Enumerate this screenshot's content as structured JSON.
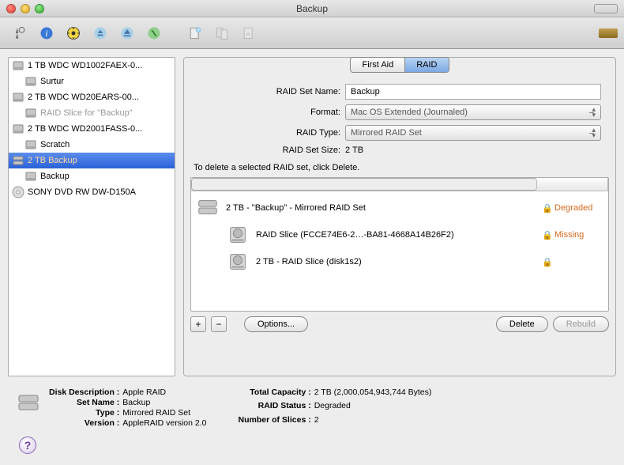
{
  "window": {
    "title": "Backup"
  },
  "sidebar": {
    "items": [
      {
        "label": "1 TB WDC WD1002FAEX-0...",
        "indent": 0,
        "icon": "hdd",
        "selected": false,
        "disabled": false
      },
      {
        "label": "Surtur",
        "indent": 1,
        "icon": "hdd",
        "selected": false,
        "disabled": false
      },
      {
        "label": "2 TB WDC WD20EARS-00...",
        "indent": 0,
        "icon": "hdd",
        "selected": false,
        "disabled": false
      },
      {
        "label": "RAID Slice for \"Backup\"",
        "indent": 1,
        "icon": "hdd",
        "selected": false,
        "disabled": true
      },
      {
        "label": "2 TB WDC WD2001FASS-0...",
        "indent": 0,
        "icon": "hdd",
        "selected": false,
        "disabled": false
      },
      {
        "label": "Scratch",
        "indent": 1,
        "icon": "hdd",
        "selected": false,
        "disabled": false
      },
      {
        "label": "2 TB Backup",
        "indent": 0,
        "icon": "raid",
        "selected": true,
        "disabled": false
      },
      {
        "label": "Backup",
        "indent": 1,
        "icon": "hdd",
        "selected": false,
        "disabled": false
      },
      {
        "label": "SONY DVD RW DW-D150A",
        "indent": 0,
        "icon": "optical",
        "selected": false,
        "disabled": false
      }
    ]
  },
  "tabs": {
    "first_aid": "First Aid",
    "raid": "RAID"
  },
  "form": {
    "name_label": "RAID Set Name:",
    "name_value": "Backup",
    "format_label": "Format:",
    "format_value": "Mac OS Extended (Journaled)",
    "type_label": "RAID Type:",
    "type_value": "Mirrored RAID Set",
    "size_label": "RAID Set Size:",
    "size_value": "2 TB"
  },
  "hint": "To delete a selected RAID set, click Delete.",
  "list": {
    "rows": [
      {
        "label": "2 TB - \"Backup\" - Mirrored RAID Set",
        "status": "Degraded",
        "locked": true,
        "child": false,
        "icon": "raid-stack"
      },
      {
        "label": "RAID Slice (FCCE74E6-2…-BA81-4668A14B26F2)",
        "status": "Missing",
        "locked": true,
        "child": true,
        "icon": "hdd-internal"
      },
      {
        "label": "2 TB - RAID Slice (disk1s2)",
        "status": "",
        "locked": true,
        "child": true,
        "icon": "hdd-internal"
      }
    ]
  },
  "actions": {
    "plus": "+",
    "minus": "−",
    "options": "Options...",
    "delete": "Delete",
    "rebuild": "Rebuild"
  },
  "footer": {
    "left": {
      "disk_desc_label": "Disk Description",
      "disk_desc_value": "Apple RAID",
      "set_name_label": "Set Name",
      "set_name_value": "Backup",
      "type_label": "Type",
      "type_value": "Mirrored RAID Set",
      "version_label": "Version",
      "version_value": "AppleRAID version 2.0"
    },
    "right": {
      "capacity_label": "Total Capacity",
      "capacity_value": "2 TB (2,000,054,943,744 Bytes)",
      "status_label": "RAID Status",
      "status_value": "Degraded",
      "slices_label": "Number of Slices",
      "slices_value": "2"
    }
  }
}
